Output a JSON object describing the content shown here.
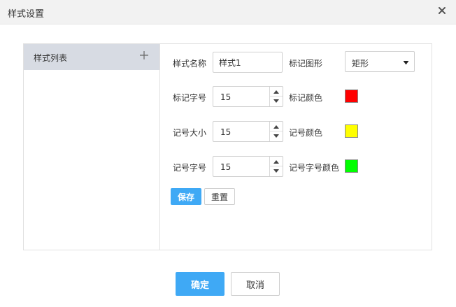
{
  "dialog": {
    "title": "样式设置",
    "close_icon": "close-icon"
  },
  "style_list": {
    "header_label": "样式列表",
    "add_icon": "plus-icon",
    "items": []
  },
  "form": {
    "style_name": {
      "label": "样式名称",
      "value": "样式1"
    },
    "marker_shape": {
      "label": "标记图形",
      "value": "矩形"
    },
    "marker_font_size": {
      "label": "标记字号",
      "value": "15"
    },
    "marker_color": {
      "label": "标记颜色",
      "color": "#ff0000"
    },
    "symbol_size": {
      "label": "记号大小",
      "value": "15"
    },
    "symbol_color": {
      "label": "记号颜色",
      "color": "#ffff00"
    },
    "symbol_font_size": {
      "label": "记号字号",
      "value": "15"
    },
    "symbol_font_color": {
      "label": "记号字号颜色",
      "color": "#00ff00"
    },
    "save_label": "保存",
    "reset_label": "重置"
  },
  "footer": {
    "ok_label": "确定",
    "cancel_label": "取消"
  },
  "colors": {
    "accent": "#3fa9f5",
    "list_header_bg": "#d7dbe3",
    "titlebar_bg": "#f2f2f2"
  }
}
